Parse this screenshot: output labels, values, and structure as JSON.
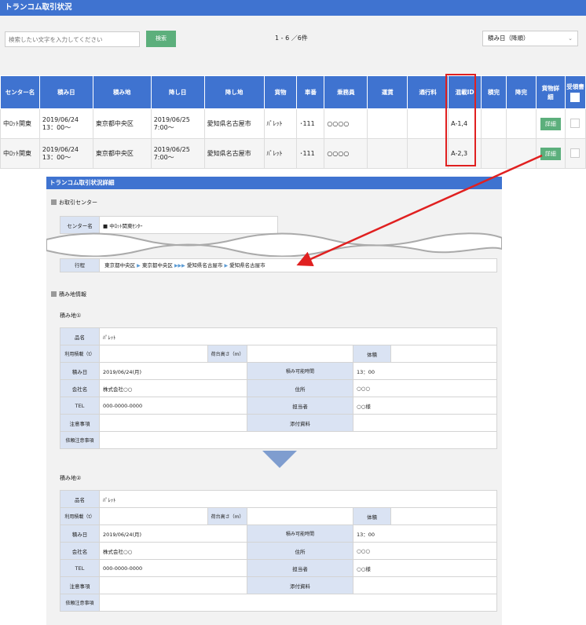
{
  "title": "トランコム取引状況",
  "search": {
    "placeholder": "検索したい文字を入力してください",
    "button": "検索"
  },
  "pagination": "1 - 6 ／6件",
  "sort": {
    "value": "積み日（降順）"
  },
  "table": {
    "headers": [
      "センター名",
      "積み日",
      "積み地",
      "降し日",
      "降し地",
      "貨物",
      "車番",
      "乗務員",
      "運賃",
      "通行料",
      "混載ID",
      "積完",
      "降完",
      "貨物詳細",
      "受領書"
    ],
    "rows": [
      {
        "center": "中ﾛｯﾄ関東",
        "load_date": "2019/06/24\n13：00～",
        "load_place": "東京都中央区",
        "unload_date": "2019/06/25\n7:00～",
        "unload_place": "愛知県名古屋市",
        "cargo": "ﾊﾟﾚｯﾄ",
        "car": "･111",
        "crew": "○○○○",
        "fare": "",
        "toll": "",
        "mixed_id": "A-1,4",
        "detail": "詳細"
      },
      {
        "center": "中ﾛｯﾄ関東",
        "load_date": "2019/06/24\n13：00～",
        "load_place": "東京都中央区",
        "unload_date": "2019/06/25\n7:00～",
        "unload_place": "愛知県名古屋市",
        "cargo": "ﾊﾟﾚｯﾄ",
        "car": "･111",
        "crew": "○○○○",
        "fare": "",
        "toll": "",
        "mixed_id": "A-2,3",
        "detail": "詳細"
      }
    ]
  },
  "detail": {
    "title": "トランコム取引状況詳細",
    "sec_center": "お取引センター",
    "center_label": "センター名",
    "center_value": "■ 中ﾛｯﾄ関東ｾﾝﾀｰ",
    "route_label": "行程",
    "route": [
      "東京都中央区",
      "東京都中央区",
      "愛知県名古屋市",
      "愛知県名古屋市"
    ],
    "sec_load": "積み地情報",
    "blocks": [
      {
        "heading": "積み地①"
      },
      {
        "heading": "積み地②"
      }
    ],
    "fields": {
      "item": "品名",
      "item_v": "ﾊﾟﾚｯﾄ",
      "weight": "利用積載（t）",
      "height": "荷台高さ（m）",
      "volume": "体積",
      "date": "積み日",
      "date_v": "2019/06/24(月)",
      "time": "積み可能時間",
      "time_v": "13：00",
      "company": "会社名",
      "company_v": "株式会社○○",
      "addr": "住所",
      "addr_v": "○○○",
      "tel": "TEL",
      "tel_v": "000-0000-0000",
      "person": "担当者",
      "person_v": "○○様",
      "notes": "注意事項",
      "attach": "添付資料",
      "req": "依頼注意事項"
    }
  },
  "colors": {
    "header": "#3f73d0",
    "green": "#5caf7c",
    "highlight": "#e02020",
    "label_bg": "#dae3f3"
  }
}
